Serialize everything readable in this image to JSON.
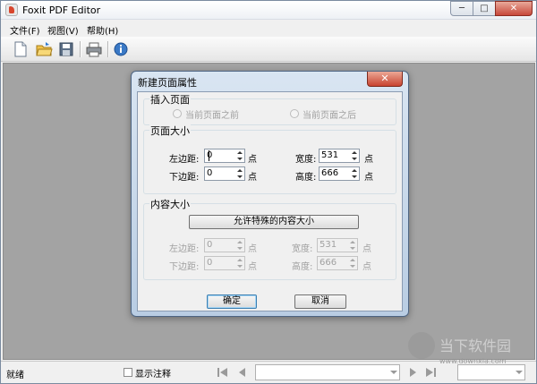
{
  "window": {
    "title": "Foxit PDF Editor",
    "caption": {
      "minimize": "─",
      "maximize": "□",
      "close": "✕"
    }
  },
  "menu": [
    "文件(F)",
    "视图(V)",
    "帮助(H)"
  ],
  "toolbar": {
    "icons": [
      "new-document-icon",
      "open-folder-icon",
      "save-icon",
      "print-icon",
      "info-icon"
    ]
  },
  "dialog": {
    "title": "新建页面属性",
    "close": "✕",
    "insert_group": {
      "title": "插入页面",
      "before": "当前页面之前",
      "after": "当前页面之后"
    },
    "size_group": {
      "title": "页面大小",
      "left_margin_label": "左边距:",
      "left_margin_value": "0",
      "bottom_margin_label": "下边距:",
      "bottom_margin_value": "0",
      "width_label": "宽度:",
      "width_value": "531",
      "height_label": "高度:",
      "height_value": "666",
      "unit": "点"
    },
    "content_group": {
      "title": "内容大小",
      "allow_button": "允许特殊的内容大小",
      "left_margin_label": "左边距:",
      "left_margin_value": "0",
      "bottom_margin_label": "下边距:",
      "bottom_margin_value": "0",
      "width_label": "宽度:",
      "width_value": "531",
      "height_label": "高度:",
      "height_value": "666",
      "unit": "点"
    },
    "ok": "确定",
    "cancel": "取消"
  },
  "status": {
    "ready": "就绪",
    "show_annotations": "显示注释"
  },
  "watermark": {
    "brand": "当下软件园",
    "url": "www.downxia.com"
  }
}
